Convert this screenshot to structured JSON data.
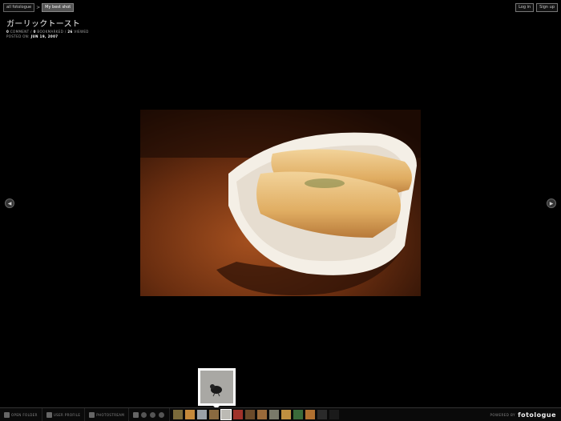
{
  "breadcrumbs": [
    "all fotologue",
    "My best shot"
  ],
  "header": {
    "login_label": "Log in",
    "signup_label": "Sign up"
  },
  "photo": {
    "title": "ガーリックトースト",
    "comments": "0",
    "comments_label": "COMMENT",
    "bookmarks": "0",
    "bookmarks_label": "BOOKMARKED",
    "views": "26",
    "views_label": "VIEWED",
    "posted_label": "POSTED ON:",
    "posted_date": "JUN 19, 2007"
  },
  "bottom": {
    "open_folder": "OPEN FOLDER",
    "user_profile": "USER PROFILE",
    "photostream": "PHOTOSTREAM",
    "powered_by": "POWERED BY",
    "brand": "fotologue"
  },
  "thumbnails": [
    {
      "color": "#7a6a3a"
    },
    {
      "color": "#c5893a"
    },
    {
      "color": "#9aa0a6"
    },
    {
      "color": "#8a6a40"
    },
    {
      "color": "#bcbab4",
      "active": true
    },
    {
      "color": "#a0322a"
    },
    {
      "color": "#6a4a2a"
    },
    {
      "color": "#9a6a3a"
    },
    {
      "color": "#7a7a6a"
    },
    {
      "color": "#c09040"
    },
    {
      "color": "#3a6a3a"
    },
    {
      "color": "#b07030"
    },
    {
      "color": "#2a2a2a"
    },
    {
      "color": "#1a1a1a"
    }
  ]
}
